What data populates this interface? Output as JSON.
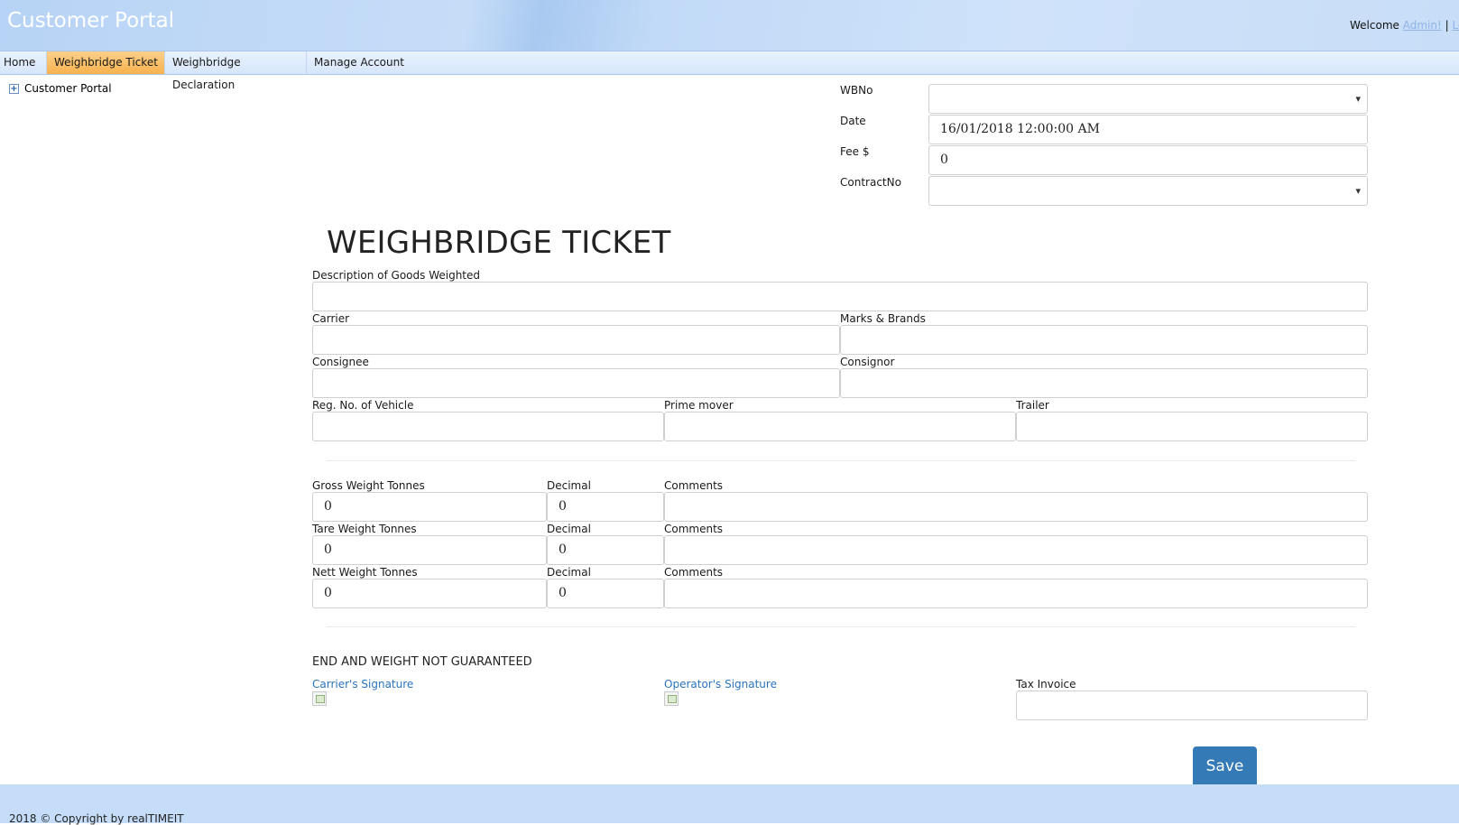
{
  "header": {
    "title": "Customer Portal",
    "welcome_text": "Welcome",
    "user_link": "Admin!",
    "logout_link": "Lo"
  },
  "menu": {
    "items": [
      {
        "label": "Home"
      },
      {
        "label": "Weighbridge Ticket",
        "active": true
      },
      {
        "label": "Weighbridge Declaration"
      },
      {
        "label": "Manage Account"
      }
    ]
  },
  "sidebar": {
    "tree_root": "Customer Portal",
    "tree_icon": "expand-plus-icon"
  },
  "topform": {
    "wbno_label": "WBNo",
    "wbno_value": "",
    "date_label": "Date",
    "date_value": "16/01/2018 12:00:00 AM",
    "fee_label": "Fee $",
    "fee_value": "0",
    "contract_label": "ContractNo",
    "contract_value": ""
  },
  "ticket": {
    "title": "WEIGHBRIDGE TICKET",
    "description_label": "Description of Goods Weighted",
    "description_value": "",
    "carrier_label": "Carrier",
    "carrier_value": "",
    "marks_label": "Marks & Brands",
    "marks_value": "",
    "consignee_label": "Consignee",
    "consignee_value": "",
    "consignor_label": "Consignor",
    "consignor_value": "",
    "reg_label": "Reg. No. of Vehicle",
    "reg_value": "",
    "prime_mover_label": "Prime mover",
    "prime_mover_value": "",
    "trailer_label": "Trailer",
    "trailer_value": ""
  },
  "weights": {
    "gross": {
      "label": "Gross Weight Tonnes",
      "value": "0",
      "decimal_label": "Decimal",
      "decimal_value": "0",
      "comments_label": "Comments",
      "comments_value": ""
    },
    "tare": {
      "label": "Tare Weight Tonnes",
      "value": "0",
      "decimal_label": "Decimal",
      "decimal_value": "0",
      "comments_label": "Comments",
      "comments_value": ""
    },
    "nett": {
      "label": "Nett Weight Tonnes",
      "value": "0",
      "decimal_label": "Decimal",
      "decimal_value": "0",
      "comments_label": "Comments",
      "comments_value": ""
    }
  },
  "signatures": {
    "notice": "END AND WEIGHT NOT GUARANTEED",
    "carrier_link": "Carrier's Signature",
    "operator_link": "Operator's Signature",
    "tax_invoice_label": "Tax Invoice",
    "tax_invoice_value": ""
  },
  "actions": {
    "save_label": "Save"
  },
  "footer": {
    "copyright": "2018 © Copyright by realTIMEIT"
  },
  "colors": {
    "menu_active": "#f7b24e",
    "link": "#2a74c0",
    "save_button": "#337ab7",
    "footer": "#c6ddf9"
  }
}
